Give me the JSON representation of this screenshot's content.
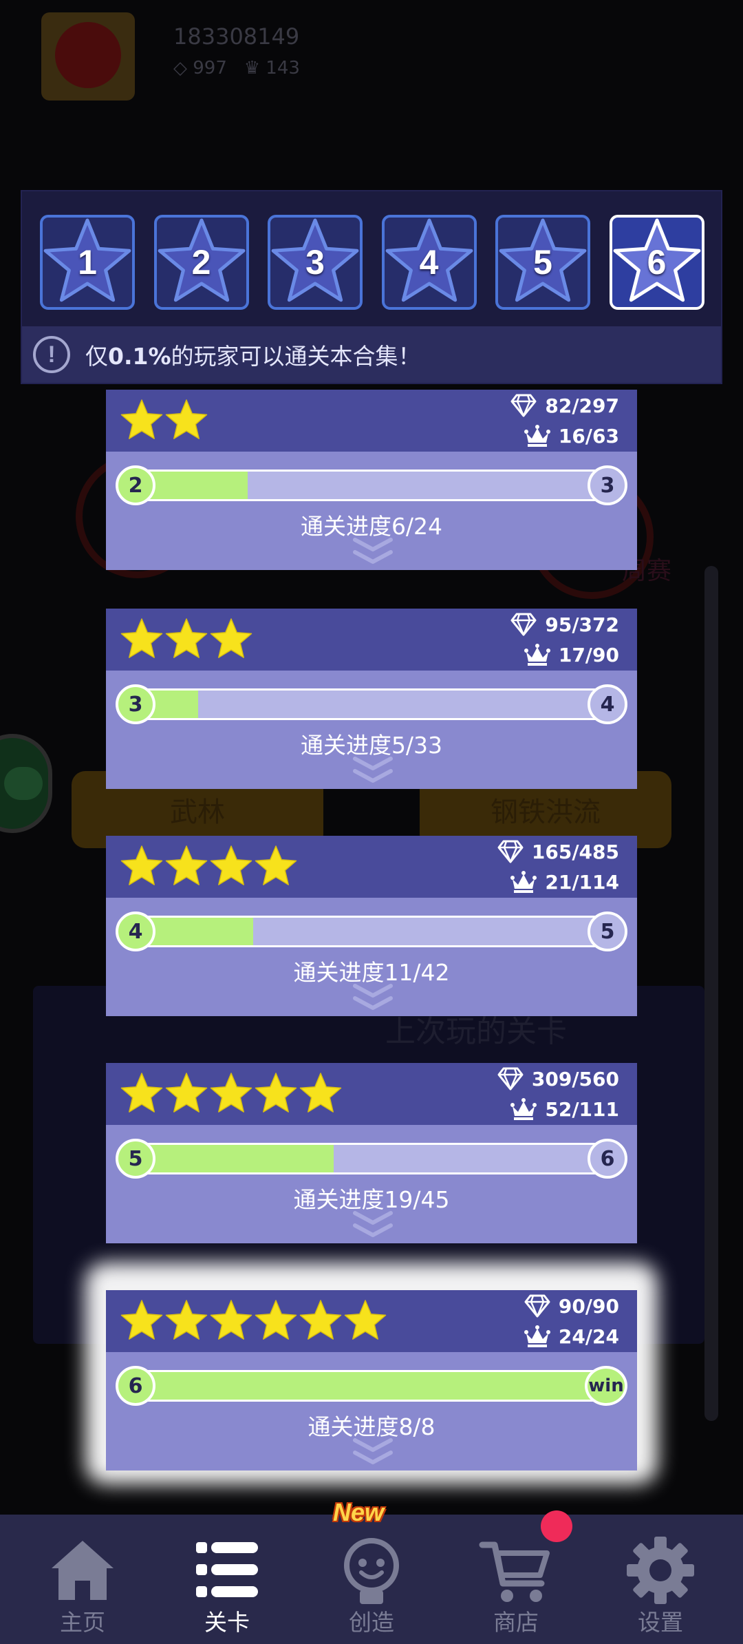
{
  "background": {
    "user_id": "183308149",
    "diamonds": "997",
    "crowns": "143",
    "buttons": [
      "武林",
      "钢铁洪流"
    ],
    "side_label": "周赛",
    "card_title": "上次玩的关卡"
  },
  "collection_tabs": [
    {
      "label": "1",
      "active": false
    },
    {
      "label": "2",
      "active": false
    },
    {
      "label": "3",
      "active": false
    },
    {
      "label": "4",
      "active": false
    },
    {
      "label": "5",
      "active": false
    },
    {
      "label": "6",
      "active": true
    }
  ],
  "notice": {
    "prefix": "仅",
    "highlight": "0.1%",
    "suffix": "的玩家可以通关本合集！"
  },
  "levels": [
    {
      "stars": 2,
      "diamonds": "82/297",
      "crowns": "16/63",
      "from": "2",
      "to": "3",
      "progress": 0.25,
      "progress_text": "通关进度6/24"
    },
    {
      "stars": 3,
      "diamonds": "95/372",
      "crowns": "17/90",
      "from": "3",
      "to": "4",
      "progress": 0.152,
      "progress_text": "通关进度5/33"
    },
    {
      "stars": 4,
      "diamonds": "165/485",
      "crowns": "21/114",
      "from": "4",
      "to": "5",
      "progress": 0.262,
      "progress_text": "通关进度11/42"
    },
    {
      "stars": 5,
      "diamonds": "309/560",
      "crowns": "52/111",
      "from": "5",
      "to": "6",
      "progress": 0.422,
      "progress_text": "通关进度19/45"
    },
    {
      "stars": 6,
      "diamonds": "90/90",
      "crowns": "24/24",
      "from": "6",
      "to": "win",
      "progress": 1.0,
      "progress_text": "通关进度8/8"
    }
  ],
  "nav": {
    "items": [
      {
        "label": "主页",
        "icon": "home-icon",
        "active": false
      },
      {
        "label": "关卡",
        "icon": "list-icon",
        "active": true
      },
      {
        "label": "创造",
        "icon": "lightbulb-icon",
        "active": false
      },
      {
        "label": "商店",
        "icon": "cart-icon",
        "active": false
      },
      {
        "label": "设置",
        "icon": "gear-icon",
        "active": false
      }
    ],
    "new_badge": "New"
  },
  "colors": {
    "accent_green": "#b6f07c",
    "panel": "#1b1b3e",
    "card": "#8989cf",
    "card_top": "#494b9b",
    "star": "#f7e21c",
    "badge_red": "#ef2b59"
  }
}
